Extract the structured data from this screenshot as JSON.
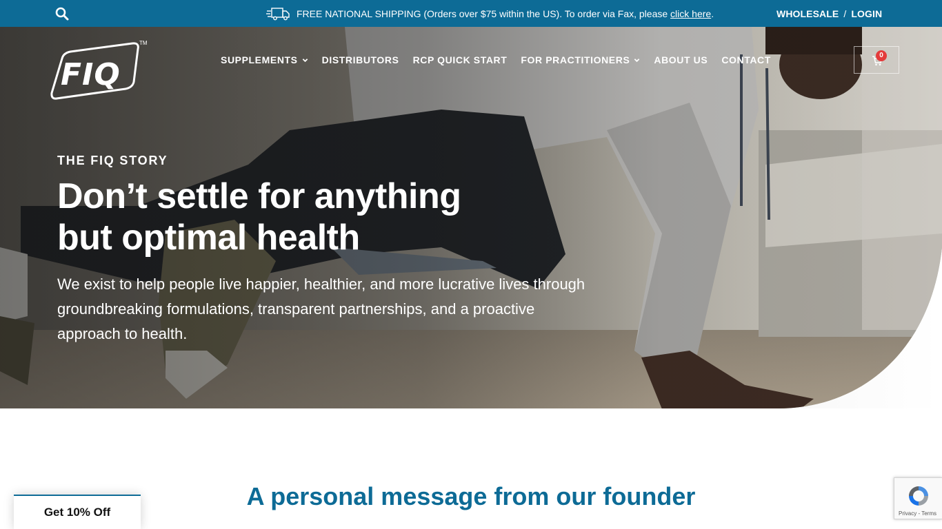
{
  "topbar": {
    "search_icon": "search-icon",
    "truck_icon": "delivery-truck-icon",
    "shipping_text": "FREE NATIONAL SHIPPING (Orders over $75 within the US). To order via Fax, please ",
    "shipping_link": "click here",
    "shipping_end": ".",
    "wholesale": "WHOLESALE",
    "separator": "/",
    "login": "LOGIN",
    "bg_color": "#0d6b96"
  },
  "header": {
    "logo_text": "FIQ",
    "logo_tm": "TM",
    "nav": [
      {
        "label": "SUPPLEMENTS",
        "dropdown": true
      },
      {
        "label": "DISTRIBUTORS",
        "dropdown": false
      },
      {
        "label": "RCP QUICK START",
        "dropdown": false
      },
      {
        "label": "FOR PRACTITIONERS",
        "dropdown": true
      },
      {
        "label": "ABOUT US",
        "dropdown": false
      },
      {
        "label": "CONTACT",
        "dropdown": false
      }
    ],
    "cart_icon": "shopping-cart-icon",
    "cart_count": "0"
  },
  "hero": {
    "kicker": "THE FIQ STORY",
    "headline_line1": "Don’t settle for anything",
    "headline_line2": "but optimal health",
    "intro": "We exist to help people live happier, healthier, and more lucrative lives through groundbreaking formulations, transparent partnerships, and a proactive approach to health."
  },
  "founder": {
    "title": "A personal message from our founder",
    "color": "#0d6b96"
  },
  "promo": {
    "label": "Get 10% Off"
  },
  "recaptcha": {
    "icon": "recaptcha-icon",
    "privacy": "Privacy",
    "sep": " - ",
    "terms": "Terms"
  }
}
